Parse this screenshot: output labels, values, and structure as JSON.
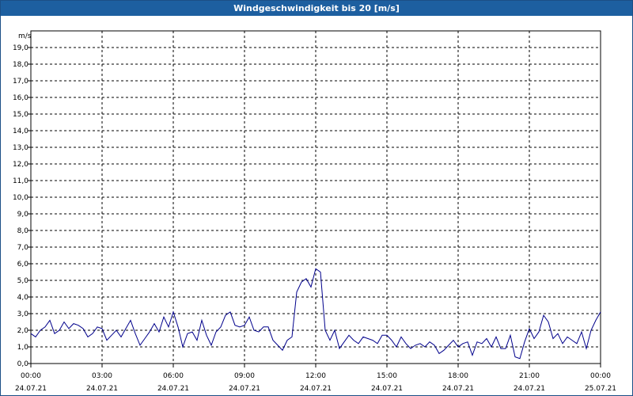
{
  "window": {
    "title": "Windgeschwindigkeit bis 20 [m/s]"
  },
  "chart_data": {
    "type": "line",
    "title": "Windgeschwindigkeit bis 20 [m/s]",
    "ylabel": "m/s",
    "xlabel": "",
    "ylim": [
      0,
      20
    ],
    "xlim": [
      0,
      24
    ],
    "grid": true,
    "line_color": "#00008b",
    "y_ticks": [
      "0,0",
      "1,0",
      "2,0",
      "3,0",
      "4,0",
      "5,0",
      "6,0",
      "7,0",
      "8,0",
      "9,0",
      "10,0",
      "11,0",
      "12,0",
      "13,0",
      "14,0",
      "15,0",
      "16,0",
      "17,0",
      "18,0",
      "19,0"
    ],
    "x_ticks": [
      {
        "time": "00:00",
        "date": "24.07.21"
      },
      {
        "time": "03:00",
        "date": "24.07.21"
      },
      {
        "time": "06:00",
        "date": "24.07.21"
      },
      {
        "time": "09:00",
        "date": "24.07.21"
      },
      {
        "time": "12:00",
        "date": "24.07.21"
      },
      {
        "time": "15:00",
        "date": "24.07.21"
      },
      {
        "time": "18:00",
        "date": "24.07.21"
      },
      {
        "time": "21:00",
        "date": "24.07.21"
      },
      {
        "time": "00:00",
        "date": "25.07.21"
      }
    ],
    "series": [
      {
        "x": [
          0,
          0.2,
          0.4,
          0.6,
          0.8,
          1.0,
          1.2,
          1.4,
          1.6,
          1.8,
          2.0,
          2.2,
          2.4,
          2.6,
          2.8,
          3.0,
          3.2,
          3.4,
          3.6,
          3.8,
          4.0,
          4.2,
          4.4,
          4.6,
          4.8,
          5.0,
          5.2,
          5.4,
          5.6,
          5.8,
          6.0,
          6.2,
          6.4,
          6.6,
          6.8,
          7.0,
          7.2,
          7.4,
          7.6,
          7.8,
          8.0,
          8.2,
          8.4,
          8.6,
          8.8,
          9.0,
          9.2,
          9.4,
          9.6,
          9.8,
          10.0,
          10.2,
          10.4,
          10.6,
          10.8,
          11.0,
          11.2,
          11.4,
          11.6,
          11.8,
          12.0,
          12.2,
          12.4,
          12.6,
          12.8,
          13.0,
          13.2,
          13.4,
          13.6,
          13.8,
          14.0,
          14.2,
          14.4,
          14.6,
          14.8,
          15.0,
          15.2,
          15.4,
          15.6,
          15.8,
          16.0,
          16.2,
          16.4,
          16.6,
          16.8,
          17.0,
          17.2,
          17.4,
          17.6,
          17.8,
          18.0,
          18.2,
          18.4,
          18.6,
          18.8,
          19.0,
          19.2,
          19.4,
          19.6,
          19.8,
          20.0,
          20.2,
          20.4,
          20.6,
          20.8,
          21.0,
          21.2,
          21.4,
          21.6,
          21.8,
          22.0,
          22.2,
          22.4,
          22.6,
          22.8,
          23.0,
          23.2,
          23.4,
          23.6,
          23.8,
          24.0
        ],
        "y": [
          1.8,
          1.6,
          2.0,
          2.2,
          2.6,
          1.8,
          2.0,
          2.5,
          2.1,
          2.4,
          2.3,
          2.1,
          1.6,
          1.8,
          2.2,
          2.1,
          1.4,
          1.7,
          2.0,
          1.6,
          2.1,
          2.6,
          1.8,
          1.1,
          1.5,
          1.9,
          2.4,
          1.9,
          2.8,
          2.2,
          3.1,
          2.2,
          1.0,
          1.8,
          1.9,
          1.4,
          2.6,
          1.7,
          1.1,
          1.9,
          2.2,
          2.9,
          3.1,
          2.3,
          2.2,
          2.3,
          2.8,
          2.0,
          1.9,
          2.2,
          2.2,
          1.4,
          1.1,
          0.8,
          1.4,
          1.6,
          4.3,
          4.9,
          5.1,
          4.6,
          5.7,
          5.5,
          2.0,
          1.4,
          2.0,
          0.9,
          1.3,
          1.7,
          1.4,
          1.2,
          1.6,
          1.5,
          1.4,
          1.2,
          1.7,
          1.7,
          1.4,
          1.0,
          1.6,
          1.2,
          0.9,
          1.1,
          1.2,
          1.0,
          1.3,
          1.1,
          0.6,
          0.8,
          1.1,
          1.4,
          1.0,
          1.2,
          1.3,
          0.5,
          1.3,
          1.2,
          1.5,
          1.0,
          1.6,
          0.9,
          0.9,
          1.7,
          0.4,
          0.3,
          1.3,
          2.1,
          1.5,
          1.9,
          2.9,
          2.5,
          1.5,
          1.8,
          1.2,
          1.6,
          1.4,
          1.2,
          1.9,
          0.9,
          2.0,
          2.6,
          3.1
        ]
      }
    ]
  }
}
